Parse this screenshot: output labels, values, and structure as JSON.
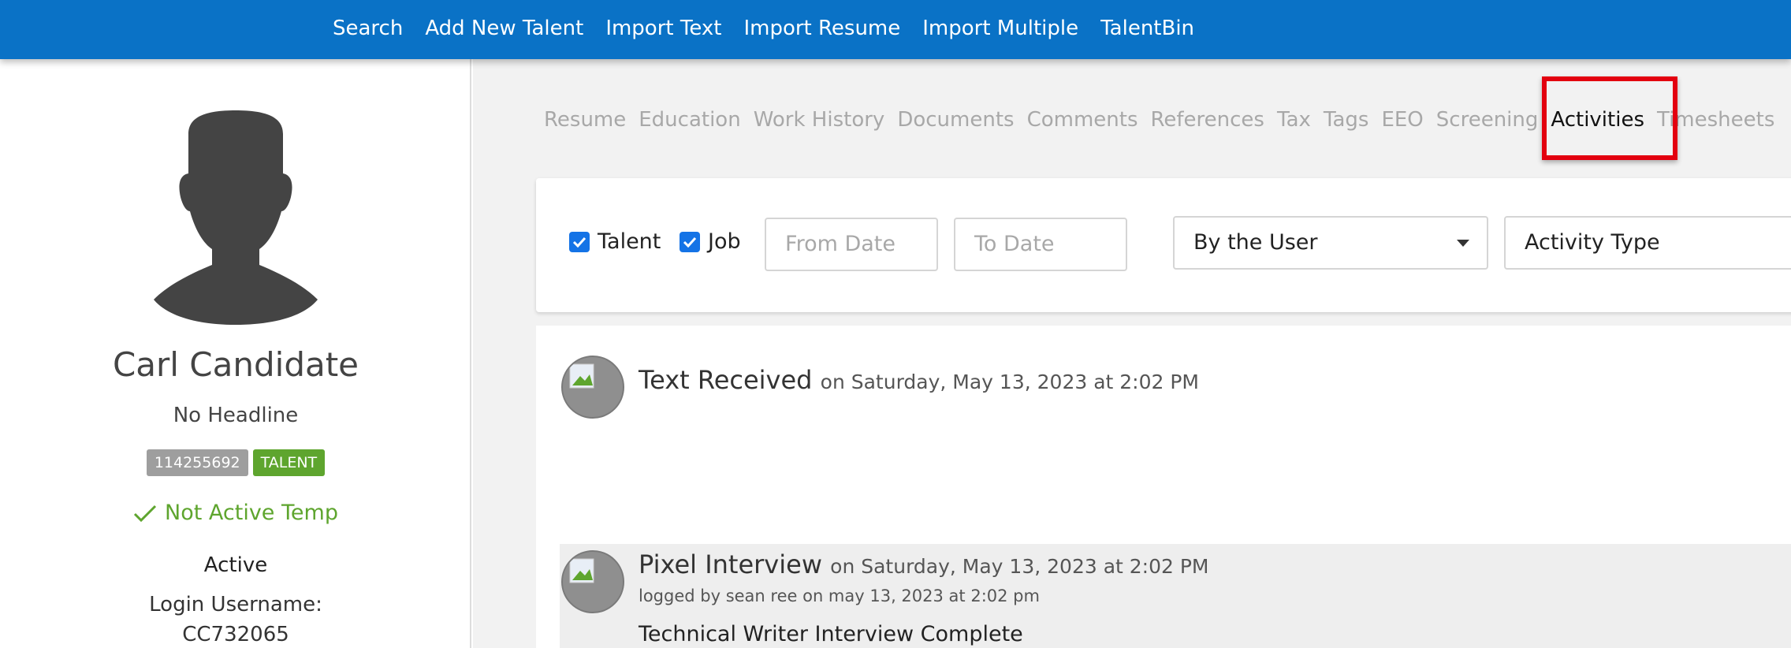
{
  "topnav": {
    "items": [
      "Search",
      "Add New Talent",
      "Import Text",
      "Import Resume",
      "Import Multiple",
      "TalentBin"
    ]
  },
  "profile": {
    "name": "Carl Candidate",
    "headline": "No Headline",
    "id_badge": "114255692",
    "type_badge": "TALENT",
    "temp_status": "Not Active Temp",
    "status": "Active",
    "login_label": "Login Username:",
    "login_value": "CC732065"
  },
  "tabs": {
    "items": [
      "Resume",
      "Education",
      "Work History",
      "Documents",
      "Comments",
      "References",
      "Tax",
      "Tags",
      "EEO",
      "Screening",
      "Activities",
      "Timesheets"
    ],
    "active": "Activities"
  },
  "filters": {
    "talent_label": "Talent",
    "job_label": "Job",
    "from_date_placeholder": "From Date",
    "to_date_placeholder": "To Date",
    "user_select": "By the User",
    "activity_type_select": "Activity Type"
  },
  "activities": [
    {
      "title": "Text Received",
      "when": "on Saturday, May 13, 2023 at 2:02 PM"
    },
    {
      "title": "Pixel Interview",
      "when": "on Saturday, May 13, 2023 at 2:02 PM",
      "logged": "logged by sean ree on may 13, 2023 at 2:02 pm",
      "body": "Technical Writer Interview Complete"
    }
  ],
  "colors": {
    "topbar": "#0a72c6",
    "success": "#5ea52e",
    "highlight": "#e3000f",
    "checkbox": "#1473e6"
  }
}
